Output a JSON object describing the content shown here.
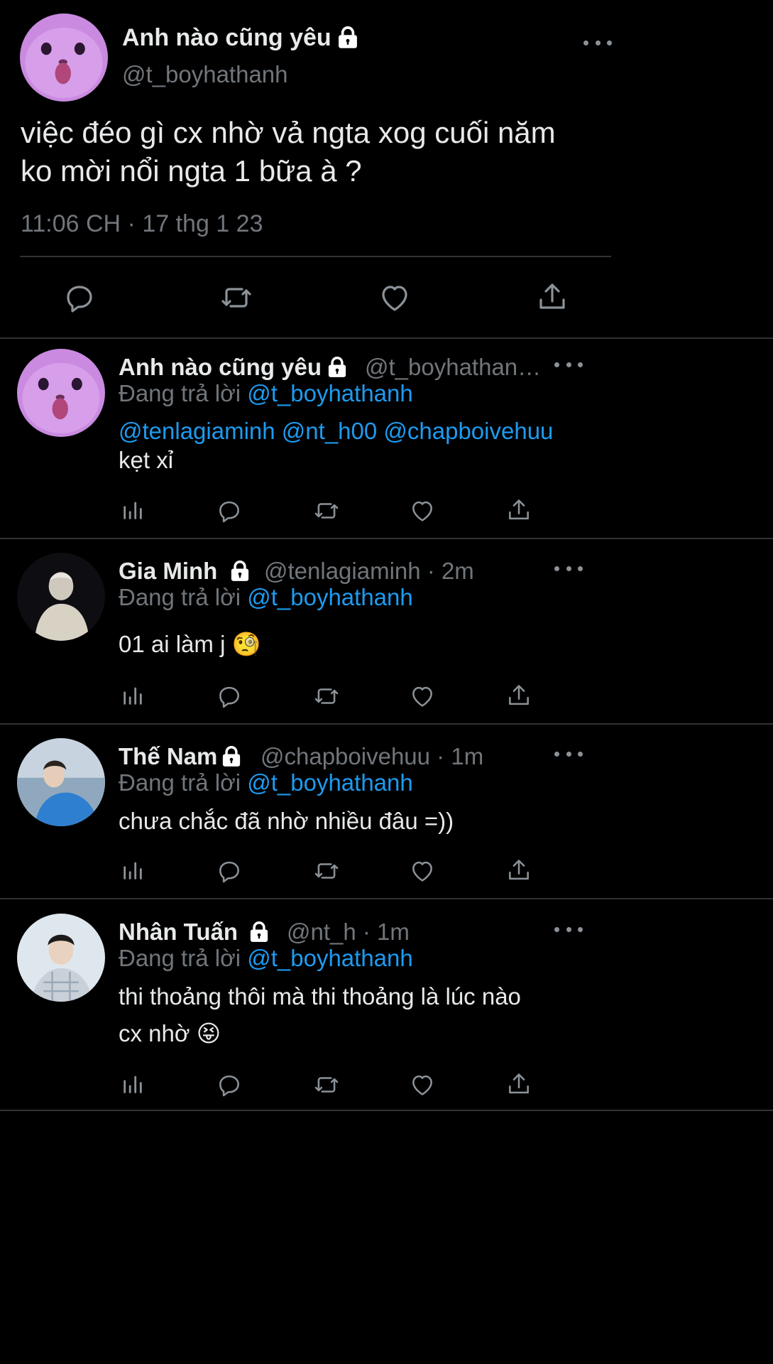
{
  "main_tweet": {
    "display_name": "Anh nào cũng yêu",
    "handle": "@t_boyhathanh",
    "text_line1": "việc đéo gì cx nhờ vả ngta xog cuối năm",
    "text_line2": "ko mời nổi ngta 1 bữa à ?",
    "timestamp": "11:06 CH · 17 thg 1 23",
    "avatar_icon": "cat-avatar",
    "locked": true
  },
  "replies": [
    {
      "display_name": "Anh nào cũng yêu",
      "handle": "@t_boyhathan…",
      "replying_label": "Đang trả lời",
      "replying_to": "@t_boyhathanh",
      "mentions": "@tenlagiaminh @nt_h00 @chapboivehuu",
      "text": "kẹt xỉ",
      "avatar_icon": "cat-avatar"
    },
    {
      "display_name": "Gia Minh",
      "handle": "@tenlagiaminh · 2m",
      "replying_label": "Đang trả lời",
      "replying_to": "@t_boyhathanh",
      "text": "01 ai làm j",
      "emoji": "🧐",
      "avatar_icon": "person-avatar"
    },
    {
      "display_name": "Thế Nam",
      "handle": "@chapboivehuu · 1m",
      "replying_label": "Đang trả lời",
      "replying_to": "@t_boyhathanh",
      "text": "chưa chắc đã nhờ nhiều đâu =))",
      "avatar_icon": "person-avatar"
    },
    {
      "display_name": "Nhân Tuấn",
      "handle": "@nt_h · 1m",
      "replying_label": "Đang trả lời",
      "replying_to": "@t_boyhathanh",
      "text_line1": "thi thoảng thôi mà thi thoảng là lúc nào",
      "text_line2": "cx nhờ",
      "emoji": "😝",
      "avatar_icon": "person-avatar"
    }
  ],
  "colors": {
    "background": "#000000",
    "text": "#e7e9ea",
    "secondary": "#71767b",
    "link": "#1d9bf0",
    "divider": "#2f3336",
    "cat_avatar": "#c98ae0"
  }
}
